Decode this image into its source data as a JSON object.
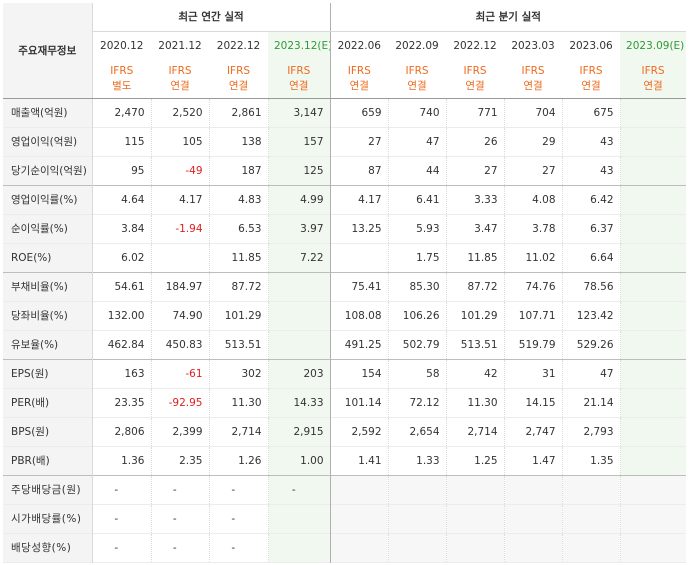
{
  "corner_label": "주요재무정보",
  "annual_group": "최근 연간 실적",
  "quarter_group": "최근 분기 실적",
  "periods": [
    {
      "label": "2020.12",
      "std1": "IFRS",
      "std2": "별도",
      "est": false
    },
    {
      "label": "2021.12",
      "std1": "IFRS",
      "std2": "연결",
      "est": false
    },
    {
      "label": "2022.12",
      "std1": "IFRS",
      "std2": "연결",
      "est": false
    },
    {
      "label": "2023.12(E)",
      "std1": "IFRS",
      "std2": "연결",
      "est": true
    },
    {
      "label": "2022.06",
      "std1": "IFRS",
      "std2": "연결",
      "est": false
    },
    {
      "label": "2022.09",
      "std1": "IFRS",
      "std2": "연결",
      "est": false
    },
    {
      "label": "2022.12",
      "std1": "IFRS",
      "std2": "연결",
      "est": false
    },
    {
      "label": "2023.03",
      "std1": "IFRS",
      "std2": "연결",
      "est": false
    },
    {
      "label": "2023.06",
      "std1": "IFRS",
      "std2": "연결",
      "est": false
    },
    {
      "label": "2023.09(E)",
      "std1": "IFRS",
      "std2": "연결",
      "est": true
    }
  ],
  "rows": [
    {
      "label": "매출액(억원)",
      "values": [
        "2,470",
        "2,520",
        "2,861",
        "3,147",
        "659",
        "740",
        "771",
        "704",
        "675",
        ""
      ]
    },
    {
      "label": "영업이익(억원)",
      "values": [
        "115",
        "105",
        "138",
        "157",
        "27",
        "47",
        "26",
        "29",
        "43",
        ""
      ]
    },
    {
      "label": "당기순이익(억원)",
      "values": [
        "95",
        "-49",
        "187",
        "125",
        "87",
        "44",
        "27",
        "27",
        "43",
        ""
      ],
      "section_end": true
    },
    {
      "label": "영업이익률(%)",
      "values": [
        "4.64",
        "4.17",
        "4.83",
        "4.99",
        "4.17",
        "6.41",
        "3.33",
        "4.08",
        "6.42",
        ""
      ]
    },
    {
      "label": "순이익률(%)",
      "values": [
        "3.84",
        "-1.94",
        "6.53",
        "3.97",
        "13.25",
        "5.93",
        "3.47",
        "3.78",
        "6.37",
        ""
      ]
    },
    {
      "label": "ROE(%)",
      "values": [
        "6.02",
        "",
        "11.85",
        "7.22",
        "",
        "1.75",
        "11.85",
        "11.02",
        "6.64",
        ""
      ],
      "section_end": true
    },
    {
      "label": "부채비율(%)",
      "values": [
        "54.61",
        "184.97",
        "87.72",
        "",
        "75.41",
        "85.30",
        "87.72",
        "74.76",
        "78.56",
        ""
      ]
    },
    {
      "label": "당좌비율(%)",
      "values": [
        "132.00",
        "74.90",
        "101.29",
        "",
        "108.08",
        "106.26",
        "101.29",
        "107.71",
        "123.42",
        ""
      ]
    },
    {
      "label": "유보율(%)",
      "values": [
        "462.84",
        "450.83",
        "513.51",
        "",
        "491.25",
        "502.79",
        "513.51",
        "519.79",
        "529.26",
        ""
      ],
      "section_end": true
    },
    {
      "label": "EPS(원)",
      "values": [
        "163",
        "-61",
        "302",
        "203",
        "154",
        "58",
        "42",
        "31",
        "47",
        ""
      ]
    },
    {
      "label": "PER(배)",
      "values": [
        "23.35",
        "-92.95",
        "11.30",
        "14.33",
        "101.14",
        "72.12",
        "11.30",
        "14.15",
        "21.14",
        ""
      ]
    },
    {
      "label": "BPS(원)",
      "values": [
        "2,806",
        "2,399",
        "2,714",
        "2,915",
        "2,592",
        "2,654",
        "2,714",
        "2,747",
        "2,793",
        ""
      ]
    },
    {
      "label": "PBR(배)",
      "values": [
        "1.36",
        "2.35",
        "1.26",
        "1.00",
        "1.41",
        "1.33",
        "1.25",
        "1.47",
        "1.35",
        ""
      ],
      "section_end": true
    },
    {
      "label": "주당배당금(원)",
      "values": [
        "-",
        "-",
        "-",
        "-",
        "",
        "",
        "",
        "",
        "",
        ""
      ],
      "dividend": true
    },
    {
      "label": "시가배당률(%)",
      "values": [
        "-",
        "-",
        "-",
        "",
        "",
        "",
        "",
        "",
        "",
        ""
      ],
      "dividend": true
    },
    {
      "label": "배당성향(%)",
      "values": [
        "-",
        "-",
        "-",
        "",
        "",
        "",
        "",
        "",
        "",
        ""
      ],
      "dividend": true
    }
  ],
  "colors": {
    "ifrs_text": "#ee6a1d",
    "estimate_bg": "#f1f8ef",
    "estimate_text": "#2f9a36",
    "negative": "#e02020",
    "header_bg": "#f4f4f4"
  }
}
